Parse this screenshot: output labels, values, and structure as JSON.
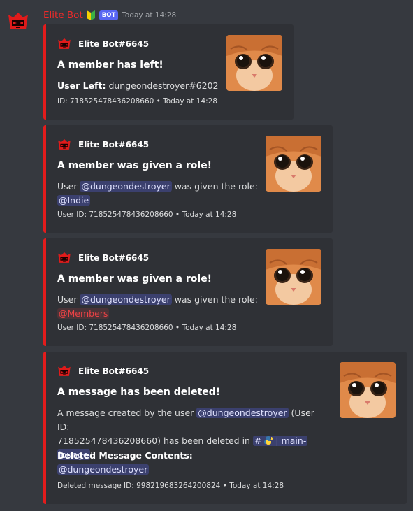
{
  "message": {
    "author": "Elite Bot",
    "bot_tag": "BOT",
    "timestamp": "Today at 14:28"
  },
  "embeds": [
    {
      "author": "Elite Bot#6645",
      "title": "A member has left!",
      "field_label": "User Left:",
      "field_value": "dungeondestroyer#6202",
      "footer": "ID: 718525478436208660 • Today at 14:28"
    },
    {
      "author": "Elite Bot#6645",
      "title": "A member was given a role!",
      "desc_prefix": "User ",
      "user_mention": "@dungeondestroyer",
      "desc_mid": " was given the role:",
      "role_mention": "@Indie",
      "footer": "User ID: 718525478436208660 • Today at 14:28"
    },
    {
      "author": "Elite Bot#6645",
      "title": "A member was given a role!",
      "desc_prefix": "User ",
      "user_mention": "@dungeondestroyer",
      "desc_mid": " was given the role:",
      "role_mention": "@Members",
      "footer": "User ID: 718525478436208660 • Today at 14:28"
    },
    {
      "author": "Elite Bot#6645",
      "title": "A message has been deleted!",
      "desc_line1_prefix": "A message created by the user ",
      "user_mention": "@dungeondestroyer",
      "desc_line1_suffix": " (User ID:",
      "desc_line2": "718525478436208660) has been deleted in ",
      "channel_symbol": "#",
      "channel_name_1": "| main-",
      "channel_name_2": "lounge",
      "desc_end": "!",
      "field_name": "Deleted Message Contents:",
      "field_value": "@dungeondestroyer",
      "footer": "Deleted message ID: 998219683264200824 • Today at 14:28"
    }
  ],
  "colors": {
    "embed_border": "#e31c1c",
    "author": "#ed2a2a",
    "bot_tag": "#5865f2"
  }
}
